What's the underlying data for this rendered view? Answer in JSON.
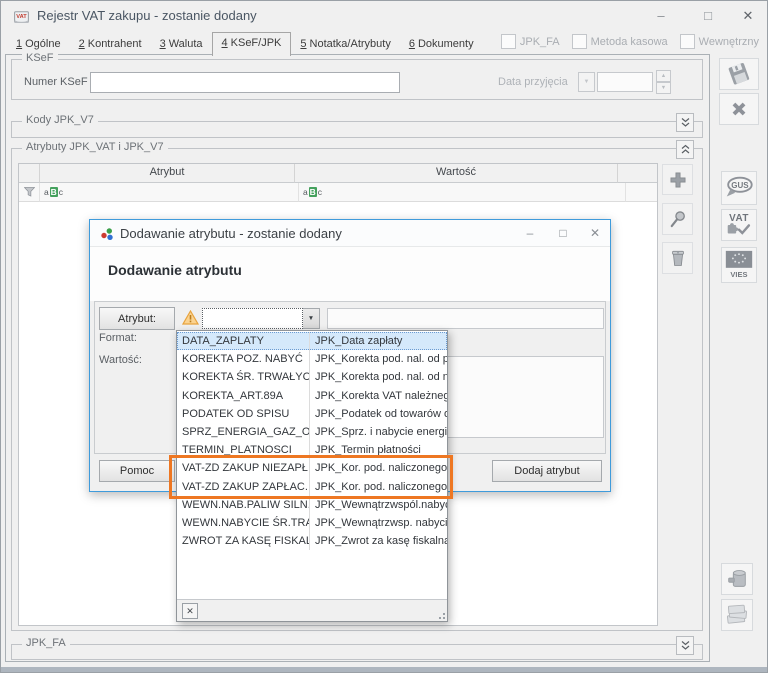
{
  "window": {
    "title": "Rejestr VAT zakupu - zostanie dodany",
    "minimize": "–",
    "maximize": "□",
    "close": "✕"
  },
  "tabs": [
    {
      "num": "1",
      "label": "Ogólne"
    },
    {
      "num": "2",
      "label": "Kontrahent"
    },
    {
      "num": "3",
      "label": "Waluta"
    },
    {
      "num": "4",
      "label": "KSeF/JPK"
    },
    {
      "num": "5",
      "label": "Notatka/Atrybuty"
    },
    {
      "num": "6",
      "label": "Dokumenty"
    }
  ],
  "header_checkboxes": [
    {
      "label": "JPK_FA",
      "checked": false
    },
    {
      "label": "Metoda kasowa",
      "checked": false
    },
    {
      "label": "Wewnętrzny",
      "checked": false
    }
  ],
  "ksef": {
    "group_label": "KSeF",
    "numer_label": "Numer KSeF",
    "numer_value": "",
    "data_przyjecia_label": "Data przyjęcia",
    "data_przyjecia_value": ""
  },
  "kody_jpk": {
    "group_label": "Kody JPK_V7"
  },
  "atrybuty": {
    "group_label": "Atrybuty JPK_VAT i JPK_V7",
    "columns": [
      "Atrybut",
      "Wartość"
    ],
    "filter_badge": {
      "pre": "a",
      "mid": "B",
      "post": "c"
    }
  },
  "jpk_fa": {
    "group_label": "JPK_FA"
  },
  "side_toolbar": {
    "gus_label": "GUS",
    "vat_label": "VAT",
    "vies_label": "VIES"
  },
  "dialog": {
    "title": "Dodawanie atrybutu - zostanie dodany",
    "heading": "Dodawanie atrybutu",
    "atrybut_button": "Atrybut:",
    "combo_value": "",
    "name_value": "",
    "format_label": "Format:",
    "wartosc_label": "Wartość:",
    "wartosc_value": "",
    "pomoc_button": "Pomoc",
    "dodaj_button": "Dodaj atrybut",
    "minimize": "–",
    "maximize": "□",
    "close": "✕"
  },
  "dropdown": {
    "items": [
      {
        "code": "DATA_ZAPLATY",
        "desc": "JPK_Data zapłaty"
      },
      {
        "code": "KOREKTA POZ. NABYĆ",
        "desc": "JPK_Korekta pod. nal. od p..."
      },
      {
        "code": "KOREKTA ŚR. TRWAŁYCH",
        "desc": "JPK_Korekta pod. nal. od n..."
      },
      {
        "code": "KOREKTA_ART.89A",
        "desc": "JPK_Korekta VAT należnego..."
      },
      {
        "code": "PODATEK OD SPISU",
        "desc": "JPK_Podatek od towarów o..."
      },
      {
        "code": "SPRZ_ENERGIA_GAZ_OO",
        "desc": "JPK_Sprz. i nabycie energii,..."
      },
      {
        "code": "TERMIN_PLATNOSCI",
        "desc": "JPK_Termin płatności"
      },
      {
        "code": "VAT-ZD ZAKUP NIEZAPŁ",
        "desc": "JPK_Kor. pod. naliczonego, ..."
      },
      {
        "code": "VAT-ZD ZAKUP ZAPŁAC.",
        "desc": "JPK_Kor. pod. naliczonego, ..."
      },
      {
        "code": "WEWN.NAB.PALIW SILN.",
        "desc": "JPK_Wewnątrzwspól.nabyc..."
      },
      {
        "code": "WEWN.NABYCIE ŚR.TRAN",
        "desc": "JPK_Wewnątrzwsp. nabyci..."
      },
      {
        "code": "ZWROT ZA KASĘ FISKAL",
        "desc": "JPK_Zwrot za kasę fiskalną"
      }
    ],
    "clear_button": "✕"
  },
  "icons": {
    "arrow_down": "▼",
    "arrow_up": "▲"
  },
  "colors": {
    "dialog_border": "#3f9bdb",
    "highlight_orange": "#ee7722",
    "selected_row": "#d5e9fb",
    "warning": "#e8a33d",
    "filter_green": "#45a15e"
  }
}
